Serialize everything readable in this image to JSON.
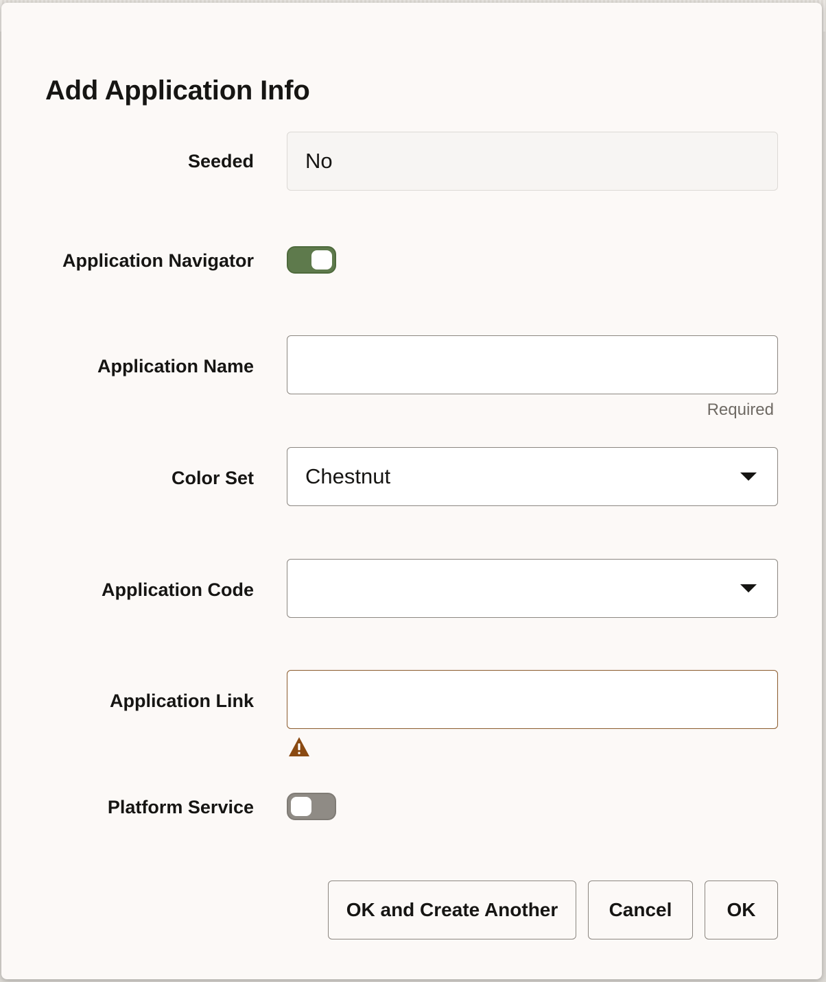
{
  "dialog": {
    "title": "Add Application Info"
  },
  "form": {
    "seeded": {
      "label": "Seeded",
      "value": "No"
    },
    "application_navigator": {
      "label": "Application Navigator",
      "enabled": true
    },
    "application_name": {
      "label": "Application Name",
      "value": "",
      "helper": "Required"
    },
    "color_set": {
      "label": "Color Set",
      "value": "Chestnut"
    },
    "application_code": {
      "label": "Application Code",
      "value": ""
    },
    "application_link": {
      "label": "Application Link",
      "value": "",
      "state": "warning"
    },
    "platform_service": {
      "label": "Platform Service",
      "enabled": false
    }
  },
  "buttons": {
    "ok_and_create_another": "OK and Create Another",
    "cancel": "Cancel",
    "ok": "OK"
  },
  "colors": {
    "toggle_on": "#5e7a4c",
    "toggle_off": "#8f8b85",
    "warning": "#8a4a12",
    "background": "#fcf9f7"
  }
}
